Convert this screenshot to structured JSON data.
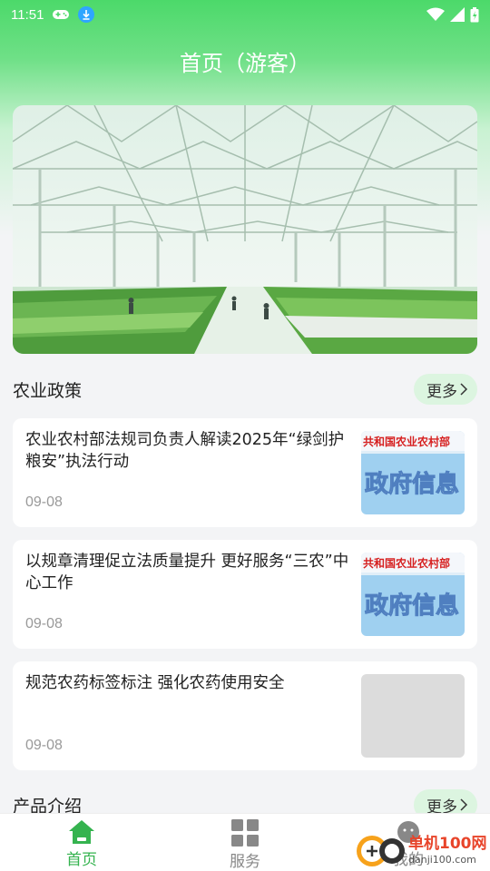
{
  "status_bar": {
    "time": "11:51"
  },
  "header": {
    "title": "首页（游客）"
  },
  "sections": {
    "policy": {
      "title": "农业政策",
      "more_label": "更多"
    },
    "products": {
      "title": "产品介绍",
      "more_label": "更多"
    }
  },
  "news": [
    {
      "title": "农业农村部法规司负责人解读2025年“绿剑护粮安”执法行动",
      "date": "09-08",
      "thumb_header": "共和国农业农村部",
      "thumb_main": "政府信息"
    },
    {
      "title": "以规章清理促立法质量提升 更好服务“三农”中心工作",
      "date": "09-08",
      "thumb_header": "共和国农业农村部",
      "thumb_main": "政府信息"
    },
    {
      "title": "规范农药标签标注 强化农药使用安全",
      "date": "09-08"
    }
  ],
  "bottom_nav": [
    {
      "label": "首页",
      "icon": "home-icon",
      "active": true
    },
    {
      "label": "服务",
      "icon": "grid-icon",
      "active": false
    },
    {
      "label": "我的",
      "icon": "profile-icon",
      "active": false
    }
  ],
  "watermark": {
    "name": "单机100网",
    "url": "danji100.com"
  },
  "colors": {
    "accent": "#35b34f",
    "more_button_bg": "#dcf5e0",
    "header_green": "#4cd96a"
  }
}
